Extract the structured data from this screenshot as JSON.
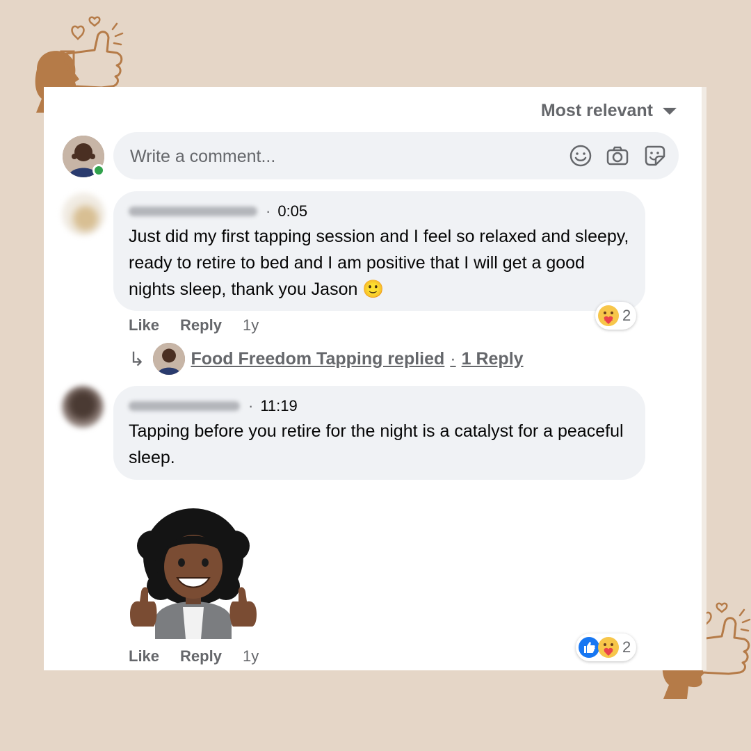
{
  "sort": {
    "label": "Most relevant"
  },
  "composer": {
    "placeholder": "Write a comment..."
  },
  "comments": [
    {
      "time": "0:05",
      "text": "Just did my first tapping session and I feel so relaxed and sleepy, ready to retire to bed and I am positive that I will get a good nights sleep, thank you Jason 🙂",
      "actions": {
        "like": "Like",
        "reply": "Reply",
        "age": "1y"
      },
      "reaction_count": "2",
      "replies": {
        "replier": "Food Freedom Tapping replied",
        "dot": "·",
        "count": "1 Reply"
      }
    },
    {
      "time": "11:19",
      "text": "Tapping before you retire for the night is a catalyst for a peaceful sleep.",
      "actions": {
        "like": "Like",
        "reply": "Reply",
        "age": "1y"
      },
      "reaction_count": "2"
    }
  ],
  "colors": {
    "background": "#e5d6c7",
    "deco": "#b57b48",
    "online": "#31a24c",
    "like_blue": "#1877f2"
  }
}
